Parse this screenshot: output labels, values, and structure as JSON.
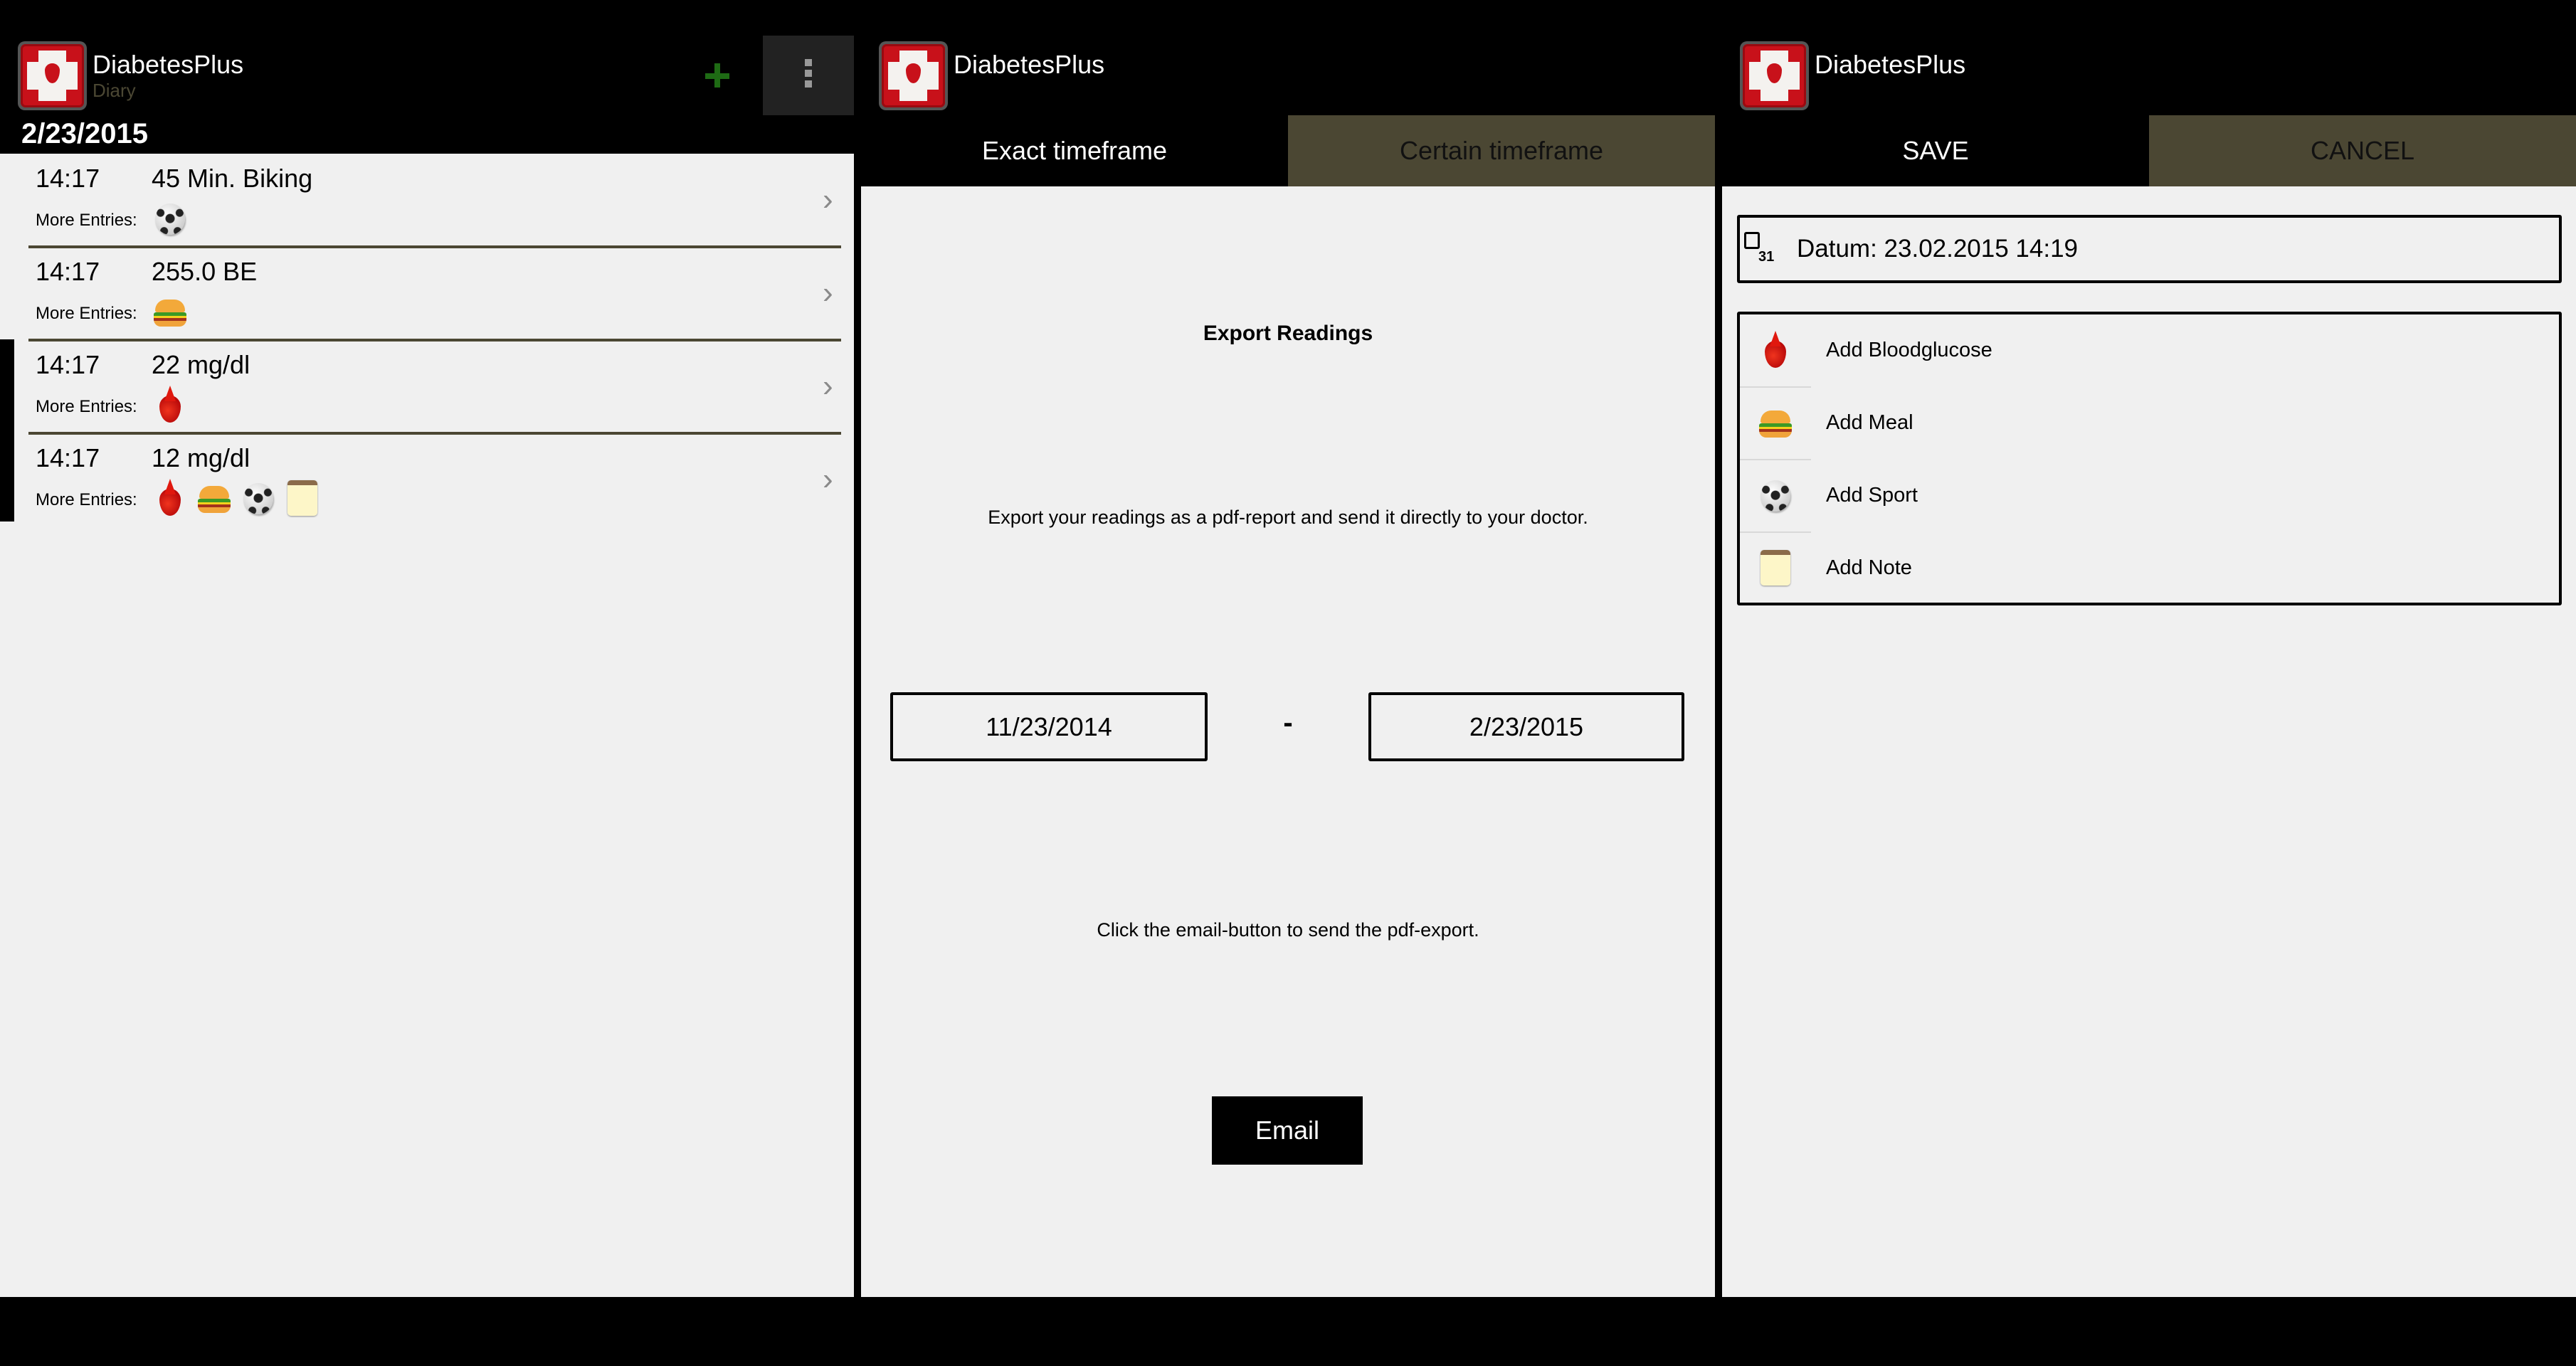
{
  "colors": {
    "accent_tab": "#4b4733",
    "plus_green": "#1e6b14",
    "content_bg": "#f0f0f0",
    "bar_bg": "#000000"
  },
  "diary": {
    "app_title": "DiabetesPlus",
    "subtitle": "Diary",
    "add_icon": "plus-icon",
    "menu_icon": "overflow-menu-icon",
    "date": "2/23/2015",
    "more_label": "More Entries:",
    "entries": [
      {
        "time": "14:17",
        "value": "45 Min. Biking",
        "icons": [
          "soccer-ball-icon"
        ]
      },
      {
        "time": "14:17",
        "value": "255.0 BE",
        "icons": [
          "burger-icon"
        ]
      },
      {
        "time": "14:17",
        "value": "22 mg/dl",
        "icons": [
          "blood-drop-icon"
        ]
      },
      {
        "time": "14:17",
        "value": "12 mg/dl",
        "icons": [
          "blood-drop-icon",
          "burger-icon",
          "soccer-ball-icon",
          "note-icon"
        ]
      }
    ],
    "chevron": "›"
  },
  "export": {
    "app_title": "DiabetesPlus",
    "tabs": [
      {
        "label": "Exact timeframe",
        "active": true
      },
      {
        "label": "Certain timeframe",
        "active": false
      }
    ],
    "title": "Export Readings",
    "description": "Export your readings as a pdf-report and send it directly to your doctor.",
    "from_date": "11/23/2014",
    "separator": "-",
    "to_date": "2/23/2015",
    "hint": "Click the email-button to send the pdf-export.",
    "email_button": "Email"
  },
  "add_entry": {
    "app_title": "DiabetesPlus",
    "save_label": "SAVE",
    "cancel_label": "CANCEL",
    "datum": "Datum: 23.02.2015 14:19",
    "calendar_icon_number": "31",
    "actions": [
      {
        "label": "Add Bloodglucose",
        "icon": "blood-drop-icon"
      },
      {
        "label": "Add Meal",
        "icon": "burger-icon"
      },
      {
        "label": "Add Sport",
        "icon": "soccer-ball-icon"
      },
      {
        "label": "Add Note",
        "icon": "note-icon"
      }
    ]
  }
}
